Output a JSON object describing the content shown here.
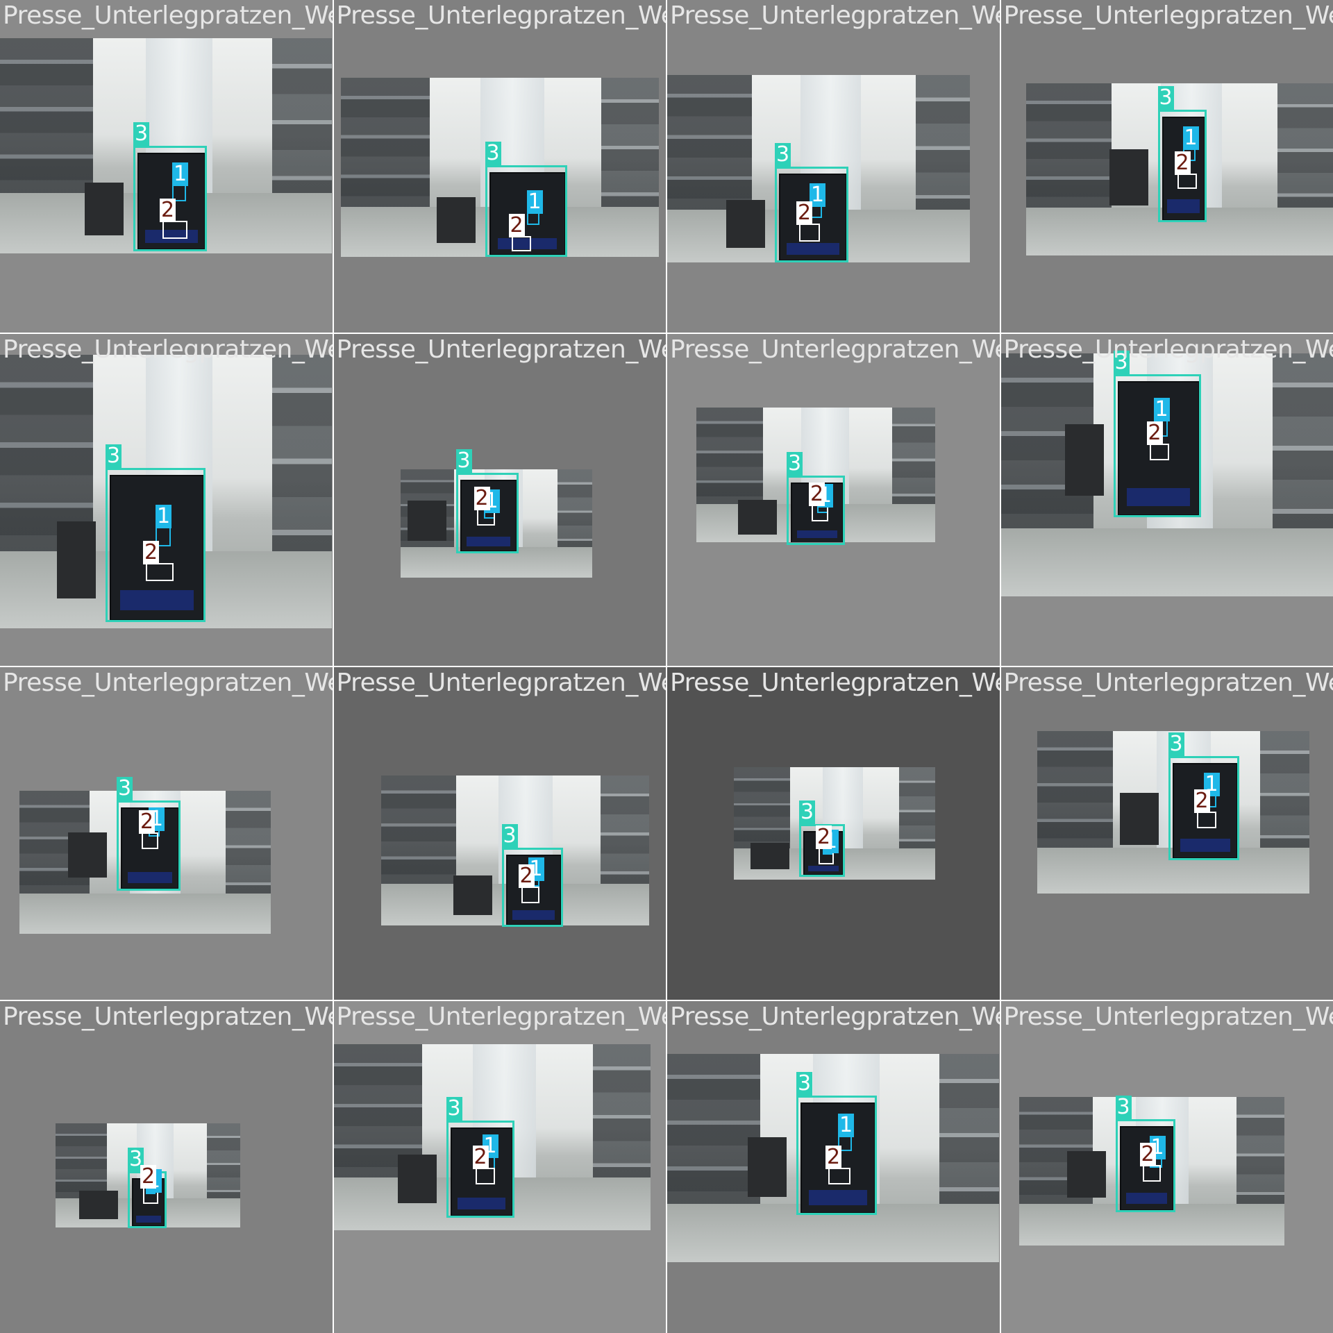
{
  "tiles": [
    {
      "caption": "Presse_Unterlegpratzen_Werkstueck_Presse",
      "bg": "#8a8a8a"
    },
    {
      "caption": "Presse_Unterlegpratzen_Werkstueck_Presse",
      "bg": "#808080"
    },
    {
      "caption": "Presse_Unterlegpratzen_Werkstueck_Presse",
      "bg": "#858585"
    },
    {
      "caption": "Presse_Unterlegpratzen_Werkstueck_Presse",
      "bg": "#808080"
    },
    {
      "caption": "Presse_Unterlegpratzen_Werkstueck_Presse",
      "bg": "#8a8a8a"
    },
    {
      "caption": "Presse_Unterlegpratzen_Werkstueck_Presse",
      "bg": "#777777"
    },
    {
      "caption": "Presse_Unterlegpratzen_Werkstueck_Presse",
      "bg": "#8c8c8c"
    },
    {
      "caption": "Presse_Unterlegpratzen_Werkstueck_Presse",
      "bg": "#8c8c8c"
    },
    {
      "caption": "Presse_Unterlegpratzen_Werkstueck_Presse",
      "bg": "#878787"
    },
    {
      "caption": "Presse_Unterlegpratzen_Werkstueck_Presse",
      "bg": "#666666"
    },
    {
      "caption": "Presse_Unterlegpratzen_Werkstueck_Presse",
      "bg": "#525252"
    },
    {
      "caption": "Presse_Unterlegpratzen_Werkstueck_Presse",
      "bg": "#7a7a7a"
    },
    {
      "caption": "Presse_Unterlegpratzen_Werkstueck_Presse",
      "bg": "#808080"
    },
    {
      "caption": "Presse_Unterlegpratzen_Werkstueck_Presse",
      "bg": "#8f8f8f"
    },
    {
      "caption": "Presse_Unterlegpratzen_Werkstueck_Presse",
      "bg": "#7e7e7e"
    },
    {
      "caption": "Presse_Unterlegpratzen_Werkstueck_Presse",
      "bg": "#8e8e8e"
    }
  ],
  "labels": {
    "press": "3",
    "pad": "1",
    "workpiece": "2"
  },
  "colors": {
    "press_box": "#2ed1b8",
    "pad_box": "#1fb8e8",
    "workpiece_box": "#ffffff",
    "workpiece_text": "#6b1b10",
    "caption": "#e6e6e6"
  }
}
